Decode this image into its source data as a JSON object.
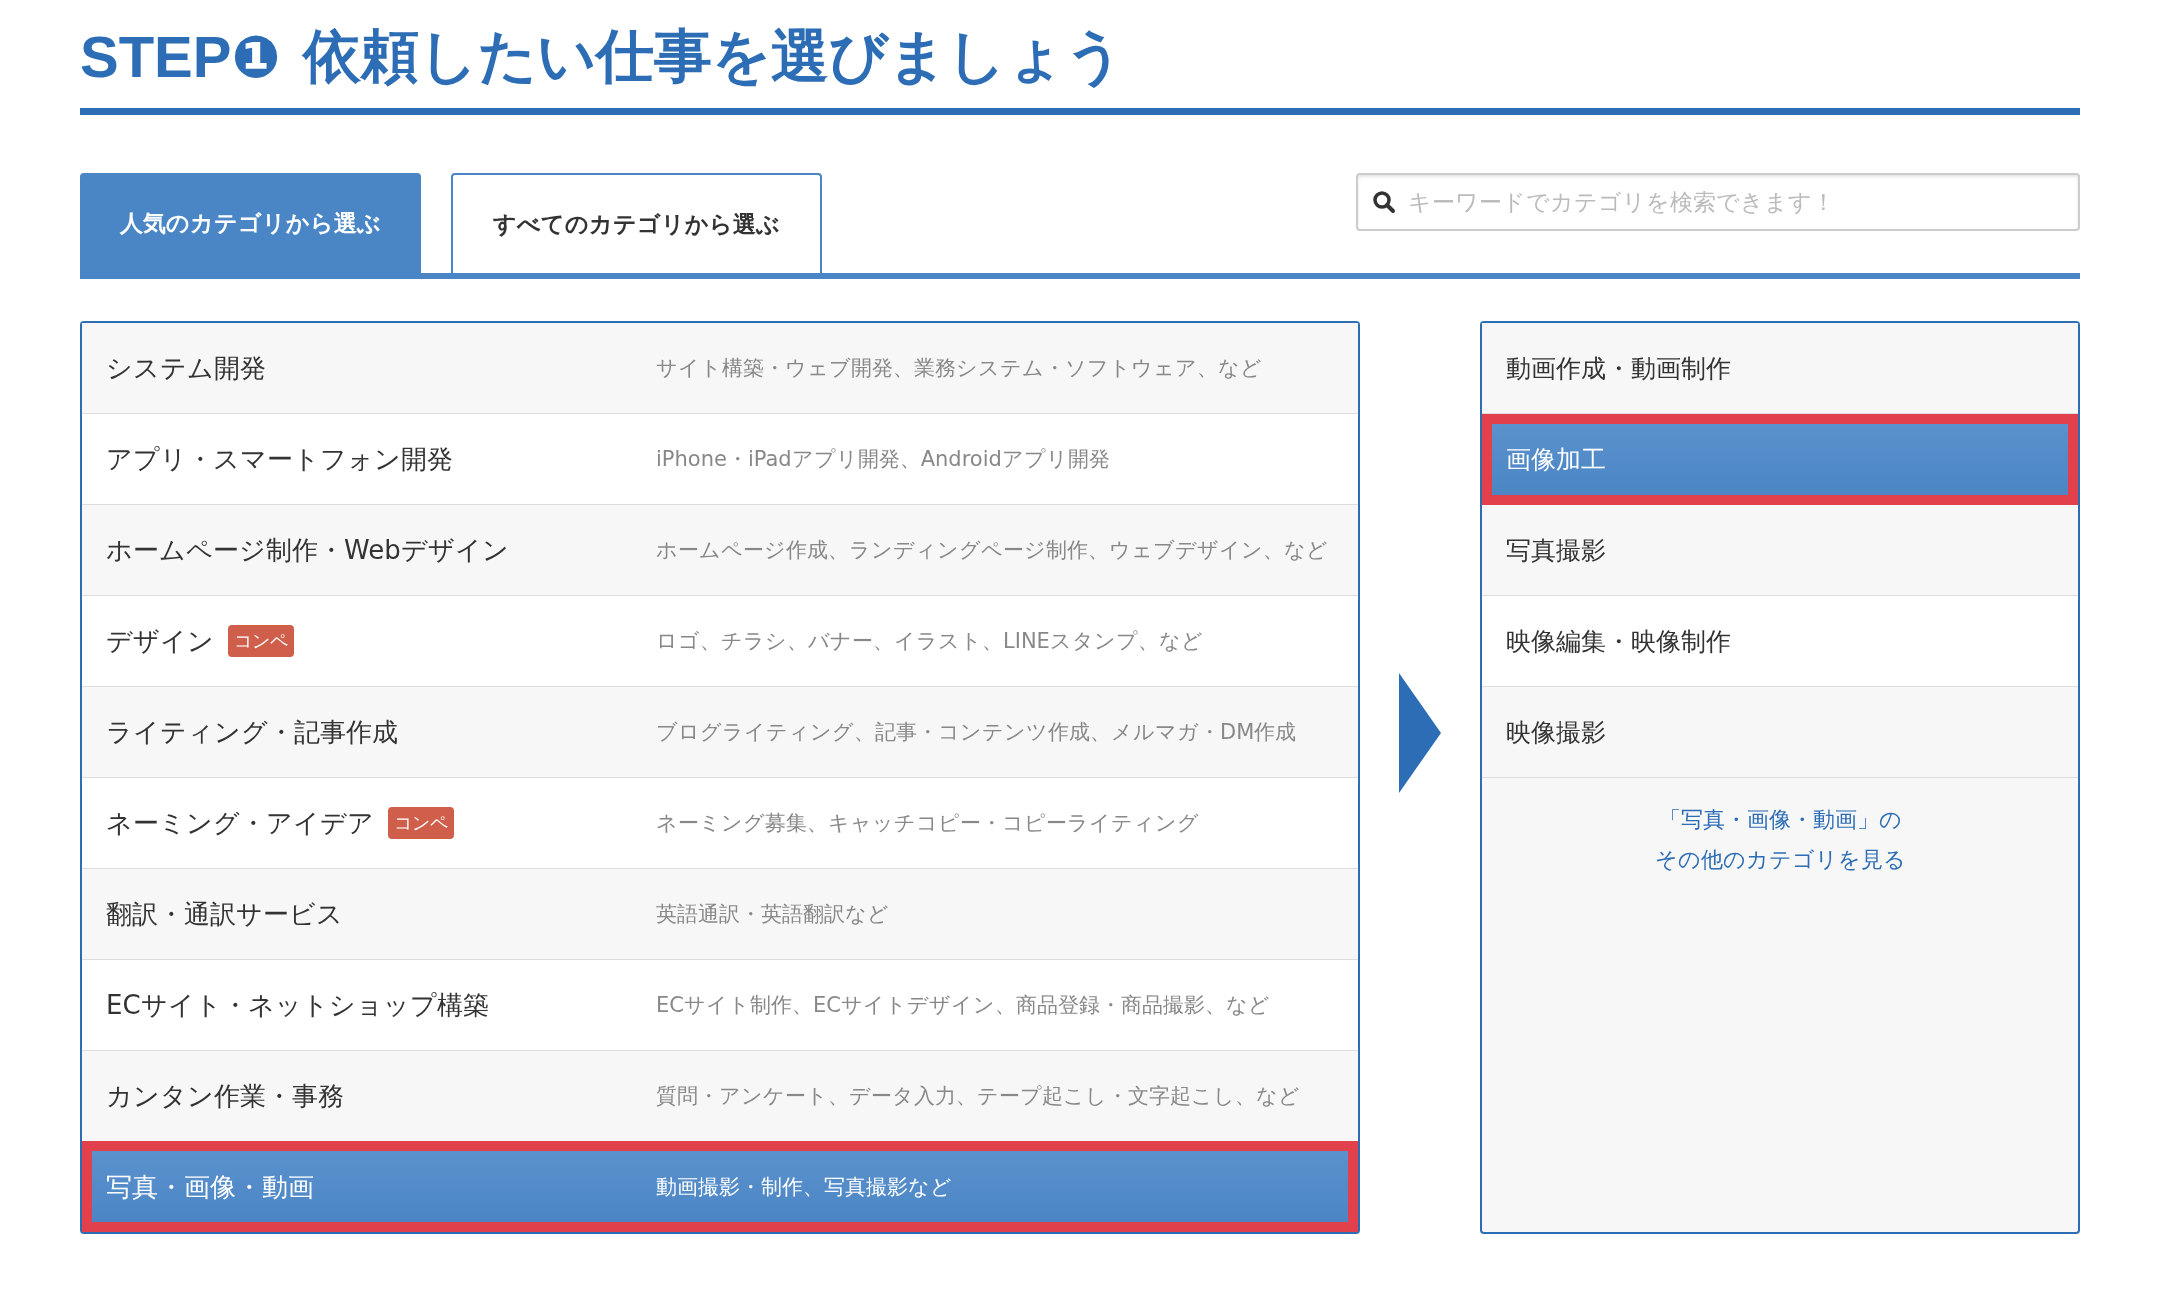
{
  "title": {
    "step": "STEP❶",
    "text": "依頼したい仕事を選びましょう"
  },
  "tabs": [
    {
      "label": "人気のカテゴリから選ぶ",
      "selected": true
    },
    {
      "label": "すべてのカテゴリから選ぶ",
      "selected": false
    }
  ],
  "search": {
    "placeholder": "キーワードでカテゴリを検索できます！"
  },
  "categories": [
    {
      "name": "システム開発",
      "description": "サイト構築・ウェブ開発、業務システム・ソフトウェア、など",
      "selected": false,
      "highlighted": false
    },
    {
      "name": "アプリ・スマートフォン開発",
      "description": "iPhone・iPadアプリ開発、Androidアプリ開発",
      "selected": false,
      "highlighted": false
    },
    {
      "name": "ホームページ制作・Webデザイン",
      "description": "ホームページ作成、ランディングページ制作、ウェブデザイン、など",
      "selected": false,
      "highlighted": false
    },
    {
      "name": "デザイン",
      "badge": "コンペ",
      "description": "ロゴ、チラシ、バナー、イラスト、LINEスタンプ、など",
      "selected": false,
      "highlighted": false
    },
    {
      "name": "ライティング・記事作成",
      "description": "ブログライティング、記事・コンテンツ作成、メルマガ・DM作成",
      "selected": false,
      "highlighted": false
    },
    {
      "name": "ネーミング・アイデア",
      "badge": "コンペ",
      "description": "ネーミング募集、キャッチコピー・コピーライティング",
      "selected": false,
      "highlighted": false
    },
    {
      "name": "翻訳・通訳サービス",
      "description": "英語通訳・英語翻訳など",
      "selected": false,
      "highlighted": false
    },
    {
      "name": "ECサイト・ネットショップ構築",
      "description": "ECサイト制作、ECサイトデザイン、商品登録・商品撮影、など",
      "selected": false,
      "highlighted": false
    },
    {
      "name": "カンタン作業・事務",
      "description": "質問・アンケート、データ入力、テープ起こし・文字起こし、など",
      "selected": false,
      "highlighted": false
    },
    {
      "name": "写真・画像・動画",
      "description": "動画撮影・制作、写真撮影など",
      "selected": true,
      "highlighted": true
    }
  ],
  "subcategories": [
    {
      "name": "動画作成・動画制作",
      "selected": false,
      "highlighted": false
    },
    {
      "name": "画像加工",
      "selected": true,
      "highlighted": true
    },
    {
      "name": "写真撮影",
      "selected": false,
      "highlighted": false
    },
    {
      "name": "映像編集・映像制作",
      "selected": false,
      "highlighted": false
    },
    {
      "name": "映像撮影",
      "selected": false,
      "highlighted": false
    }
  ],
  "more_link": [
    "「写真・画像・動画」の",
    "その他のカテゴリを見る"
  ]
}
